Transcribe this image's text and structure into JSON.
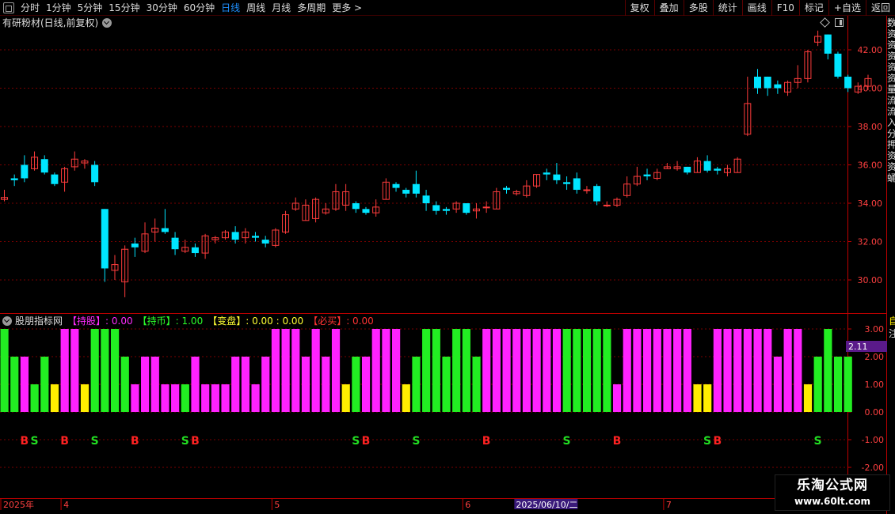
{
  "toolbar": {
    "periods": [
      "分时",
      "1分钟",
      "5分钟",
      "15分钟",
      "30分钟",
      "60分钟",
      "日线",
      "周线",
      "月线",
      "多周期",
      "更多 >"
    ],
    "active_period": "日线",
    "tools": [
      "复权",
      "叠加",
      "多股",
      "统计",
      "画线",
      "F10",
      "标记",
      "+自选",
      "返回"
    ]
  },
  "main_title": "有研粉材(日线,前复权)",
  "indicator": {
    "name": "股朋指标网",
    "items": [
      {
        "label": "【持股】",
        "value": ": 0.00",
        "color": "#ff2bff"
      },
      {
        "label": "【持币】",
        "value": ": 1.00",
        "color": "#2bff2b"
      },
      {
        "label": "【变盘】",
        "value": ": 0.00 : 0.00",
        "color": "#ffff33"
      },
      {
        "label": "【必买】",
        "value": ": 0.00",
        "color": "#ff3333"
      }
    ],
    "current_marker": "2.11"
  },
  "right_edge_chars": [
    "数",
    "资",
    "资",
    "资",
    "资",
    "资",
    "量",
    "流",
    "流",
    "入",
    "分",
    "押",
    "资",
    "资",
    "蛹"
  ],
  "right_edge_chars_lower": [
    "自",
    "注"
  ],
  "date_axis": {
    "labels": [
      {
        "text": "2025年",
        "index": 0
      },
      {
        "text": "4",
        "index": 6
      },
      {
        "text": "5",
        "index": 27
      },
      {
        "text": "6",
        "index": 46
      },
      {
        "text": "7",
        "index": 66
      }
    ],
    "cursor_label": "2025/06/10/二",
    "cursor_index": 52
  },
  "chart_data": {
    "type": "candlestick",
    "price_axis": {
      "ticks": [
        30,
        32,
        34,
        36,
        38,
        40,
        42
      ],
      "labels": [
        "30.00",
        "32.00",
        "34.00",
        "36.00",
        "38.00",
        "40.00",
        "42.00"
      ]
    },
    "indicator_axis": {
      "ticks": [
        3,
        2,
        1,
        0,
        -1,
        -2
      ],
      "labels": [
        "3.00",
        "2.00",
        "1.00",
        "0.00",
        "-1.00",
        "-2.00"
      ]
    },
    "candles": [
      [
        34.2,
        34.3,
        34.7,
        34.1
      ],
      [
        35.3,
        35.2,
        35.5,
        34.9
      ],
      [
        36.0,
        35.3,
        36.5,
        35.1
      ],
      [
        35.8,
        36.4,
        36.7,
        35.7
      ],
      [
        36.3,
        35.6,
        36.5,
        35.5
      ],
      [
        35.5,
        35.0,
        35.6,
        34.9
      ],
      [
        35.1,
        35.8,
        35.9,
        34.6
      ],
      [
        35.9,
        36.3,
        36.7,
        35.7
      ],
      [
        36.1,
        36.2,
        36.3,
        35.8
      ],
      [
        36.0,
        35.1,
        36.2,
        34.9
      ],
      [
        33.7,
        30.6,
        33.7,
        29.9
      ],
      [
        30.5,
        30.8,
        31.3,
        30.0
      ],
      [
        29.9,
        31.6,
        31.8,
        29.1
      ],
      [
        31.9,
        31.7,
        32.2,
        31.2
      ],
      [
        31.5,
        32.4,
        33.0,
        31.4
      ],
      [
        32.5,
        32.7,
        33.2,
        32.0
      ],
      [
        32.7,
        32.5,
        33.7,
        32.4
      ],
      [
        32.2,
        31.6,
        32.5,
        31.3
      ],
      [
        31.5,
        31.7,
        32.1,
        31.4
      ],
      [
        31.7,
        31.4,
        31.9,
        31.2
      ],
      [
        31.4,
        32.3,
        32.4,
        31.1
      ],
      [
        32.1,
        32.2,
        32.3,
        31.9
      ],
      [
        32.2,
        32.5,
        32.6,
        32.1
      ],
      [
        32.5,
        32.1,
        32.8,
        31.9
      ],
      [
        32.2,
        32.5,
        32.7,
        31.9
      ],
      [
        32.3,
        32.2,
        32.5,
        32.0
      ],
      [
        32.1,
        31.9,
        32.3,
        31.7
      ],
      [
        31.8,
        32.6,
        32.7,
        31.7
      ],
      [
        32.5,
        33.4,
        33.6,
        32.4
      ],
      [
        33.7,
        34.0,
        34.3,
        33.6
      ],
      [
        33.1,
        33.9,
        34.2,
        33.1
      ],
      [
        33.2,
        34.2,
        34.3,
        33.0
      ],
      [
        33.5,
        33.7,
        34.0,
        33.4
      ],
      [
        33.7,
        34.6,
        35.0,
        33.6
      ],
      [
        33.9,
        34.6,
        35.0,
        33.6
      ],
      [
        34.0,
        33.7,
        34.1,
        33.5
      ],
      [
        33.7,
        33.5,
        33.8,
        33.4
      ],
      [
        33.5,
        33.8,
        34.2,
        33.3
      ],
      [
        34.2,
        35.1,
        35.3,
        34.2
      ],
      [
        35.0,
        34.8,
        35.1,
        34.6
      ],
      [
        34.7,
        34.5,
        34.8,
        34.3
      ],
      [
        35.0,
        34.5,
        35.7,
        34.3
      ],
      [
        34.4,
        34.0,
        34.7,
        33.6
      ],
      [
        33.9,
        33.6,
        34.1,
        33.4
      ],
      [
        33.7,
        33.6,
        33.8,
        33.4
      ],
      [
        33.7,
        34.0,
        34.1,
        33.5
      ],
      [
        34.0,
        33.5,
        34.0,
        33.4
      ],
      [
        33.6,
        33.7,
        34.0,
        33.2
      ],
      [
        33.8,
        33.8,
        34.1,
        33.5
      ],
      [
        33.7,
        34.6,
        34.8,
        33.7
      ],
      [
        34.8,
        34.7,
        34.9,
        34.5
      ],
      [
        34.5,
        34.6,
        34.7,
        34.4
      ],
      [
        34.4,
        34.9,
        35.2,
        34.3
      ],
      [
        34.9,
        35.5,
        35.5,
        34.8
      ],
      [
        35.6,
        35.5,
        35.8,
        35.2
      ],
      [
        35.5,
        35.2,
        36.1,
        35.0
      ],
      [
        35.1,
        35.0,
        35.4,
        34.7
      ],
      [
        35.3,
        34.7,
        35.6,
        34.5
      ],
      [
        34.7,
        34.7,
        34.9,
        34.5
      ],
      [
        34.9,
        34.1,
        35.0,
        33.9
      ],
      [
        33.9,
        33.9,
        34.1,
        33.8
      ],
      [
        33.9,
        34.2,
        34.3,
        33.8
      ],
      [
        34.4,
        35.0,
        35.4,
        34.3
      ],
      [
        35.0,
        35.4,
        35.9,
        34.9
      ],
      [
        35.5,
        35.4,
        35.8,
        35.2
      ],
      [
        35.3,
        35.6,
        35.8,
        35.2
      ],
      [
        35.8,
        35.9,
        36.1,
        35.8
      ],
      [
        35.8,
        35.9,
        36.2,
        35.7
      ],
      [
        35.9,
        35.6,
        35.9,
        35.5
      ],
      [
        35.6,
        36.2,
        36.4,
        35.6
      ],
      [
        36.2,
        35.7,
        36.5,
        35.6
      ],
      [
        35.8,
        35.7,
        35.9,
        35.5
      ],
      [
        35.6,
        35.8,
        36.0,
        35.4
      ],
      [
        35.6,
        36.3,
        36.4,
        35.6
      ],
      [
        37.6,
        39.2,
        40.6,
        37.5
      ],
      [
        40.6,
        40.0,
        41.0,
        39.7
      ],
      [
        40.6,
        40.0,
        40.6,
        39.6
      ],
      [
        40.2,
        40.0,
        40.4,
        39.7
      ],
      [
        39.8,
        40.3,
        40.4,
        39.6
      ],
      [
        40.3,
        40.5,
        41.2,
        40.0
      ],
      [
        40.5,
        41.9,
        42.0,
        40.3
      ],
      [
        42.4,
        42.7,
        43.0,
        42.2
      ],
      [
        42.8,
        41.8,
        42.8,
        41.5
      ],
      [
        41.8,
        40.6,
        41.9,
        40.5
      ],
      [
        40.6,
        40.0,
        40.7,
        39.8
      ],
      [
        39.8,
        40.1,
        40.3,
        39.7
      ],
      [
        40.1,
        40.5,
        40.7,
        39.9
      ]
    ],
    "indicator_bars": [
      [
        "3",
        "g"
      ],
      [
        "2",
        "g"
      ],
      [
        "2",
        "m"
      ],
      [
        "1",
        "g"
      ],
      [
        "2",
        "g"
      ],
      [
        "1",
        "y"
      ],
      [
        "3",
        "m"
      ],
      [
        "3",
        "m"
      ],
      [
        "1",
        "y"
      ],
      [
        "3",
        "g"
      ],
      [
        "3",
        "g"
      ],
      [
        "3",
        "g"
      ],
      [
        "2",
        "g"
      ],
      [
        "1",
        "m"
      ],
      [
        "2",
        "m"
      ],
      [
        "2",
        "m"
      ],
      [
        "1",
        "m"
      ],
      [
        "1",
        "m"
      ],
      [
        "1",
        "g"
      ],
      [
        "2",
        "m"
      ],
      [
        "1",
        "m"
      ],
      [
        "1",
        "m"
      ],
      [
        "1",
        "m"
      ],
      [
        "2",
        "m"
      ],
      [
        "2",
        "m"
      ],
      [
        "1",
        "m"
      ],
      [
        "2",
        "m"
      ],
      [
        "3",
        "m"
      ],
      [
        "3",
        "m"
      ],
      [
        "3",
        "m"
      ],
      [
        "2",
        "m"
      ],
      [
        "3",
        "m"
      ],
      [
        "2",
        "m"
      ],
      [
        "3",
        "m"
      ],
      [
        "1",
        "y"
      ],
      [
        "2",
        "g"
      ],
      [
        "2",
        "m"
      ],
      [
        "3",
        "m"
      ],
      [
        "3",
        "m"
      ],
      [
        "3",
        "m"
      ],
      [
        "1",
        "y"
      ],
      [
        "2",
        "g"
      ],
      [
        "3",
        "g"
      ],
      [
        "3",
        "g"
      ],
      [
        "2",
        "g"
      ],
      [
        "3",
        "g"
      ],
      [
        "3",
        "g"
      ],
      [
        "2",
        "g"
      ],
      [
        "3",
        "m"
      ],
      [
        "3",
        "m"
      ],
      [
        "3",
        "m"
      ],
      [
        "3",
        "m"
      ],
      [
        "3",
        "m"
      ],
      [
        "3",
        "m"
      ],
      [
        "3",
        "m"
      ],
      [
        "3",
        "m"
      ],
      [
        "3",
        "g"
      ],
      [
        "3",
        "g"
      ],
      [
        "3",
        "g"
      ],
      [
        "3",
        "g"
      ],
      [
        "3",
        "g"
      ],
      [
        "1",
        "m"
      ],
      [
        "3",
        "m"
      ],
      [
        "3",
        "m"
      ],
      [
        "3",
        "m"
      ],
      [
        "3",
        "m"
      ],
      [
        "3",
        "m"
      ],
      [
        "3",
        "m"
      ],
      [
        "3",
        "m"
      ],
      [
        "1",
        "y"
      ],
      [
        "1",
        "y"
      ],
      [
        "3",
        "m"
      ],
      [
        "3",
        "m"
      ],
      [
        "3",
        "m"
      ],
      [
        "3",
        "m"
      ],
      [
        "3",
        "m"
      ],
      [
        "3",
        "m"
      ],
      [
        "2",
        "m"
      ],
      [
        "3",
        "m"
      ],
      [
        "3",
        "m"
      ],
      [
        "1",
        "y"
      ],
      [
        "2",
        "g"
      ],
      [
        "3",
        "g"
      ],
      [
        "2",
        "g"
      ],
      [
        "2",
        "g"
      ]
    ],
    "signals": [
      {
        "index": 2,
        "text": "B"
      },
      {
        "index": 3,
        "text": "S"
      },
      {
        "index": 6,
        "text": "B"
      },
      {
        "index": 9,
        "text": "S"
      },
      {
        "index": 13,
        "text": "B"
      },
      {
        "index": 18,
        "text": "S"
      },
      {
        "index": 19,
        "text": "B"
      },
      {
        "index": 35,
        "text": "S"
      },
      {
        "index": 36,
        "text": "B"
      },
      {
        "index": 41,
        "text": "S"
      },
      {
        "index": 48,
        "text": "B"
      },
      {
        "index": 56,
        "text": "S"
      },
      {
        "index": 61,
        "text": "B"
      },
      {
        "index": 70,
        "text": "S"
      },
      {
        "index": 71,
        "text": "B"
      },
      {
        "index": 81,
        "text": "S"
      }
    ],
    "colors": {
      "up": "#ff3c3c",
      "down": "#00e5ff",
      "magenta": "#ff22ff",
      "green": "#22ee22",
      "yellow": "#ffee00",
      "grid": "#7a0000",
      "axis": "#c00000",
      "signal_buy": "#ff2222",
      "signal_sell": "#22dd22"
    }
  },
  "watermark": {
    "title": "乐淘公式网",
    "url": "www.60lt.com"
  }
}
